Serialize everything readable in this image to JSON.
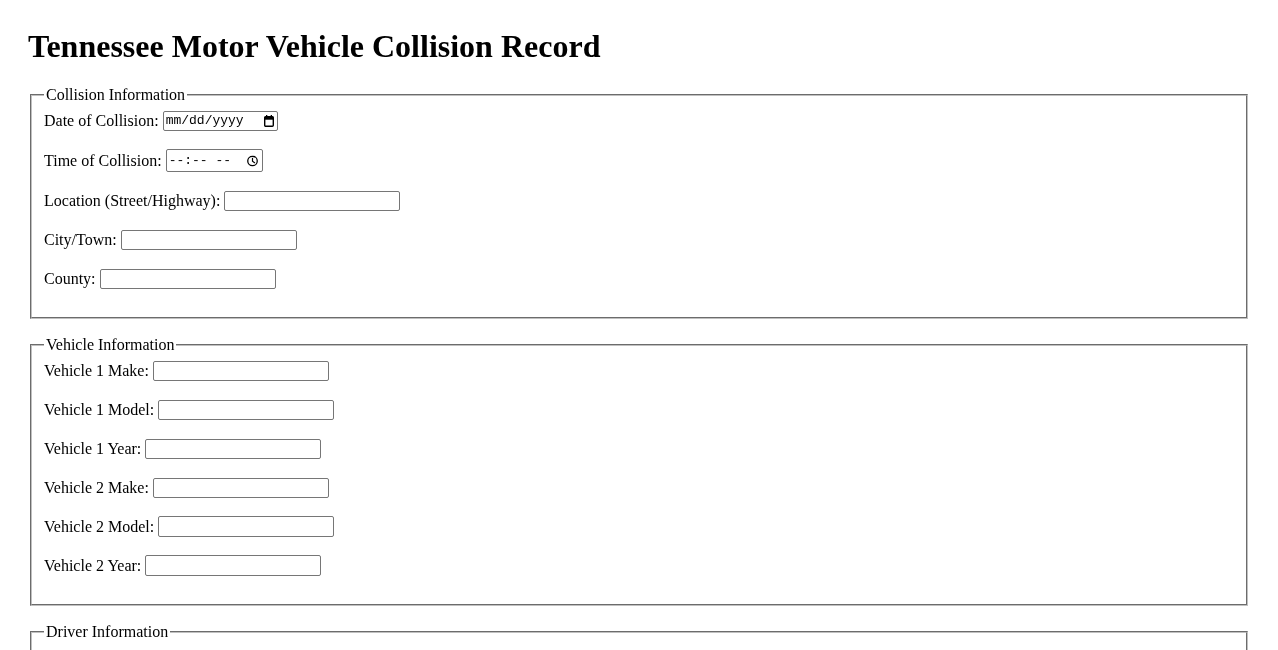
{
  "title": "Tennessee Motor Vehicle Collision Record",
  "sections": [
    {
      "legend": "Collision Information",
      "fields": [
        {
          "label": "Date of Collision:",
          "kind": "date",
          "placeholder": "mm/dd/yyyy"
        },
        {
          "label": "Time of Collision:",
          "kind": "time",
          "placeholder": "--:-- --"
        },
        {
          "label": "Location (Street/Highway):",
          "kind": "text"
        },
        {
          "label": "City/Town:",
          "kind": "text"
        },
        {
          "label": "County:",
          "kind": "text"
        }
      ]
    },
    {
      "legend": "Vehicle Information",
      "fields": [
        {
          "label": "Vehicle 1 Make:",
          "kind": "text"
        },
        {
          "label": "Vehicle 1 Model:",
          "kind": "text"
        },
        {
          "label": "Vehicle 1 Year:",
          "kind": "text"
        },
        {
          "label": "Vehicle 2 Make:",
          "kind": "text"
        },
        {
          "label": "Vehicle 2 Model:",
          "kind": "text"
        },
        {
          "label": "Vehicle 2 Year:",
          "kind": "text"
        }
      ]
    },
    {
      "legend": "Driver Information"
    }
  ]
}
